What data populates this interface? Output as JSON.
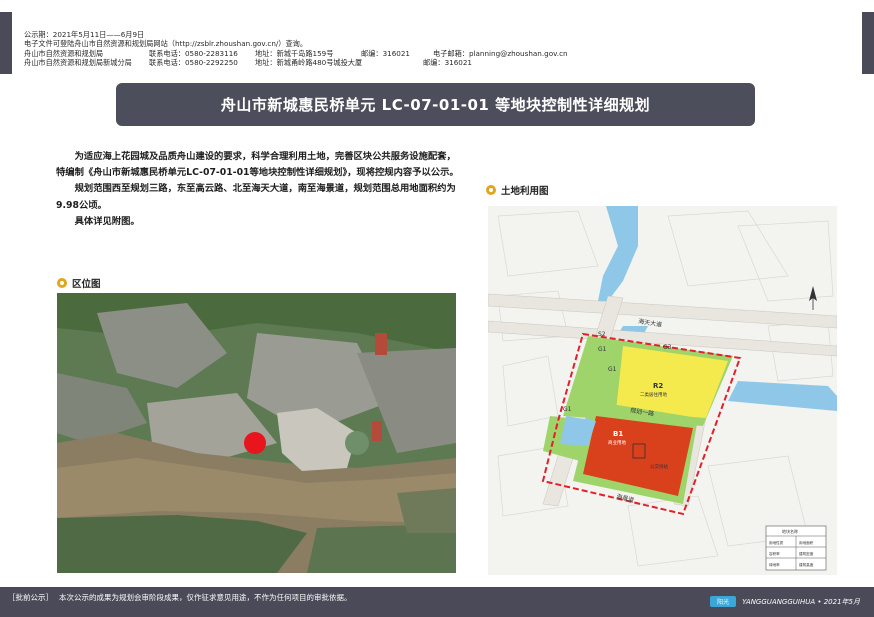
{
  "header": {
    "lines": [
      [
        "公示期：2021年5月11日——6月9日"
      ],
      [
        "电子文件可登陆舟山市自然资源和规划局网站（http://zsblr.zhoushan.gov.cn/）查询。"
      ],
      [
        "舟山市自然资源和规划局",
        "联系电话：0580-2283116",
        "地址：新城千岛路159号",
        "邮编：316021",
        "电子邮箱：planning@zhoushan.gov.cn"
      ],
      [
        "舟山市自然资源和规划局新城分局",
        "联系电话：0580-2292250",
        "地址：新城甬岭路480号城投大厦",
        "邮编：316021"
      ]
    ]
  },
  "title": "舟山市新城惠民桥单元 LC-07-01-01 等地块控制性详细规划",
  "intro": {
    "paragraphs": [
      "为适应海上花园城及品质舟山建设的要求，科学合理利用土地，完善区块公共服务设施配套，特编制《舟山市新城惠民桥单元LC-07-01-01等地块控制性详细规划》，现将控规内容予以公示。",
      "规划范围西至规划三路，东至高云路、北至海天大道，南至海景道，规划范围总用地面积约为9.98公顷。",
      "具体详见附图。"
    ]
  },
  "sections": {
    "location": "区位图",
    "landuse": "土地利用图"
  },
  "landuse_map": {
    "road_north": "海天大道",
    "road_middle": "规划一路",
    "road_south": "海景道",
    "parcels": {
      "b1": "B1",
      "b1_sub": "商业用地",
      "r2": "R2",
      "r2_sub": "二类居住用地",
      "g1_a": "G1",
      "g1_b": "G1",
      "g1_c": "G1",
      "s2": "S2",
      "g3": "G3",
      "u": "公交场站"
    },
    "legend_title": "地块名称",
    "legend_rows": [
      "用地性质",
      "用地面积",
      "容积率",
      "建筑密度",
      "绿地率",
      "建筑高度"
    ]
  },
  "footer": {
    "bracket": "［批前公示］",
    "notice": "本次公示的成果为规划会审阶段成果，仅作征求意见用途，不作为任何项目的审批依据。",
    "brand": "YANGGUANGGUIHUA • 2021年5月",
    "logo": "阳光"
  },
  "colors": {
    "banner": "#4d4e5c",
    "commercial": "#d9401c",
    "residential": "#f4ea4e",
    "green": "#9fd46a",
    "water": "#8ec7e8",
    "boundary": "#e0202a",
    "marker": "#e8141e"
  }
}
